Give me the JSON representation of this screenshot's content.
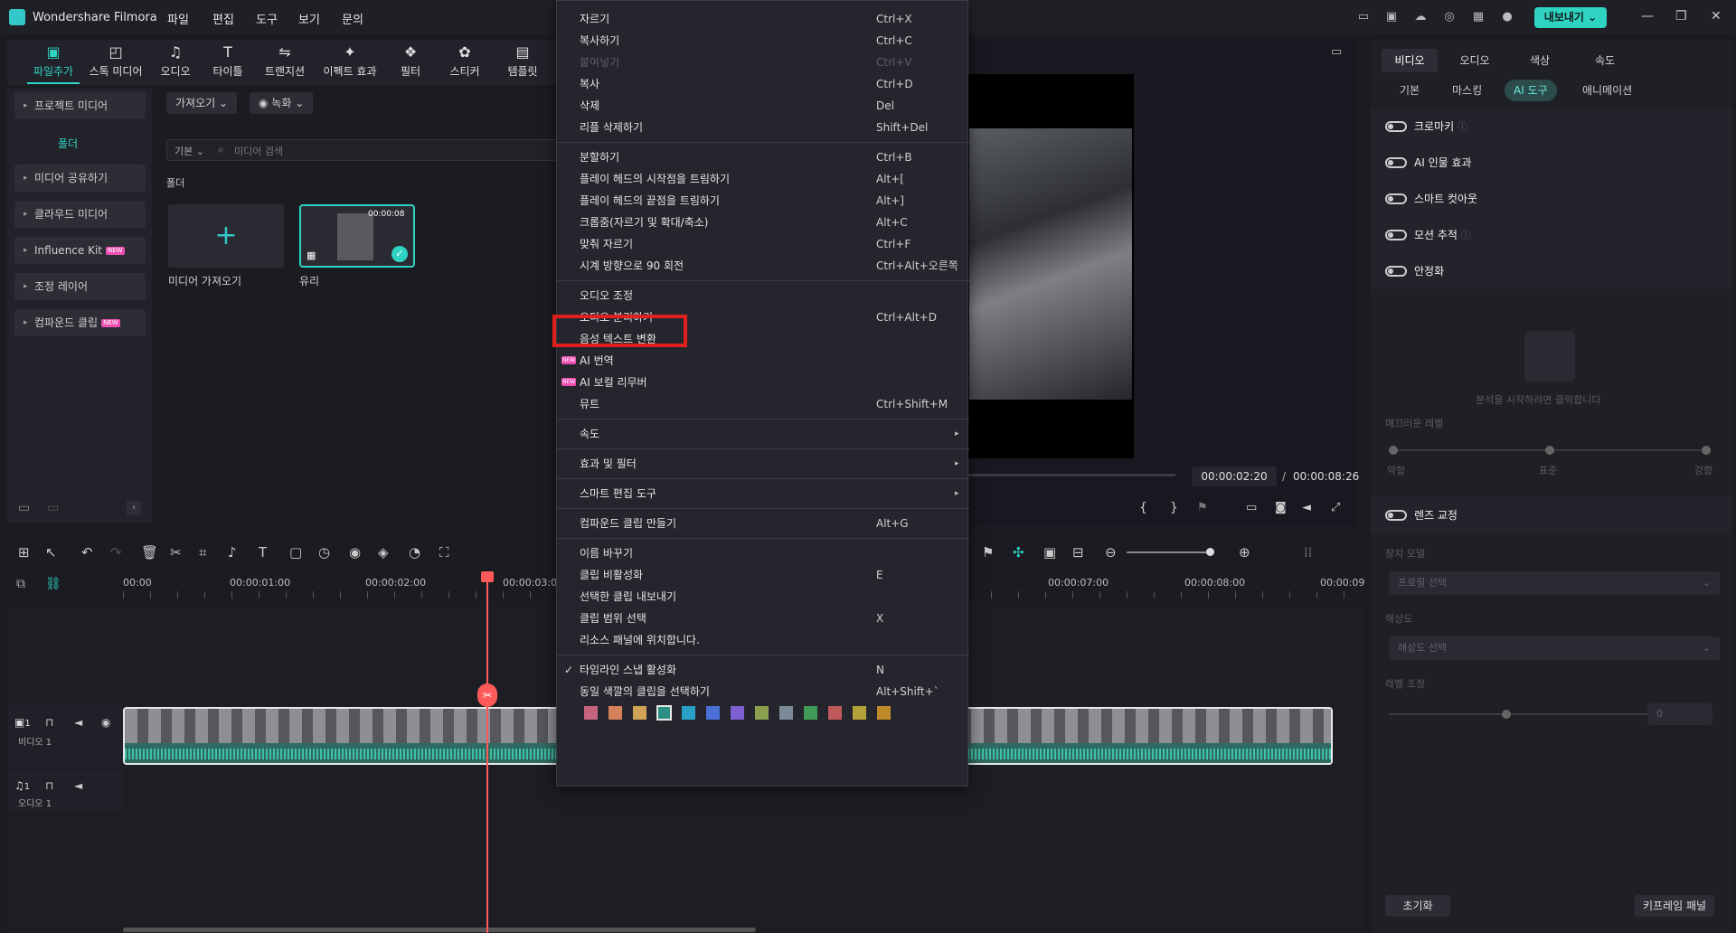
{
  "app": {
    "title": "Wondershare Filmora",
    "menus": [
      "파일",
      "편집",
      "도구",
      "보기",
      "문의"
    ],
    "export_label": "내보내기"
  },
  "toolbar": {
    "items": [
      "파일추가",
      "스톡 미디어",
      "오디오",
      "타이틀",
      "트랜지션",
      "이펙트 효과",
      "필터",
      "스티커",
      "템플릿"
    ]
  },
  "leftnav": {
    "project_media": "프로젝트 미디어",
    "folder": "폴더",
    "items": [
      "미디어 공유하기",
      "클라우드 미디어",
      "Influence Kit",
      "조정 레이어",
      "컴파운드 클립"
    ],
    "new_badge": "NEW"
  },
  "media": {
    "import_label": "가져오기",
    "record_label": "녹화",
    "view_label": "기본",
    "search_placeholder": "미디어 검색",
    "folder_label": "폴더",
    "add_media_label": "미디어 가져오기",
    "clip_name": "유리",
    "clip_duration": "00:00:08"
  },
  "preview": {
    "current_time": "00:00:02:20",
    "separator": "/",
    "total_time": "00:00:08:26"
  },
  "rightpanel": {
    "tabs": [
      "비디오",
      "오디오",
      "색상",
      "속도"
    ],
    "subtabs": [
      "기본",
      "마스킹",
      "AI 도구",
      "애니메이션"
    ],
    "toggles": [
      "크로마키",
      "AI 인물 효과",
      "스마트 컷아웃",
      "모션 추적",
      "안정화"
    ],
    "analyze_hint": "분석을 시작하려면 클릭합니다",
    "smooth_level": "매끄러운 레벨",
    "slider_labels": [
      "약함",
      "표준",
      "강함"
    ],
    "lens_correction": "렌즈 교정",
    "device_model": "장치 모델",
    "profile_select": "프로필 선택",
    "resolution": "해상도",
    "resolution_select": "해상도 선택",
    "level_adjust": "레벨 조정",
    "level_value": "0",
    "reset_label": "초기화",
    "keyframe_panel": "키프레임 패널"
  },
  "timeline": {
    "ruler": [
      "00:00",
      "00:00:01:00",
      "00:00:02:00",
      "00:00:03:0",
      "00:00:07:00",
      "00:00:08:00",
      "00:00:09"
    ],
    "video_track": "비디오 1",
    "audio_track": "오디오 1",
    "track_num": "1"
  },
  "context_menu": {
    "groups": [
      [
        {
          "label": "자르기",
          "shortcut": "Ctrl+X"
        },
        {
          "label": "복사하기",
          "shortcut": "Ctrl+C"
        },
        {
          "label": "붙여넣기",
          "shortcut": "Ctrl+V",
          "disabled": true
        },
        {
          "label": "복사",
          "shortcut": "Ctrl+D"
        },
        {
          "label": "삭제",
          "shortcut": "Del"
        },
        {
          "label": "리플 삭제하기",
          "shortcut": "Shift+Del"
        }
      ],
      [
        {
          "label": "분할하기",
          "shortcut": "Ctrl+B"
        },
        {
          "label": "플레이 헤드의 시작점을 트림하기",
          "shortcut": "Alt+["
        },
        {
          "label": "플레이 헤드의 끝점을 트림하기",
          "shortcut": "Alt+]"
        },
        {
          "label": "크롭줌(자르기 및 확대/축소)",
          "shortcut": "Alt+C"
        },
        {
          "label": "맞춰 자르기",
          "shortcut": "Ctrl+F"
        },
        {
          "label": "시계 방향으로 90 회전",
          "shortcut": "Ctrl+Alt+오른쪽"
        }
      ],
      [
        {
          "label": "오디오 조정",
          "shortcut": ""
        },
        {
          "label": "오디오 분리하기",
          "shortcut": "Ctrl+Alt+D",
          "highlighted": true
        },
        {
          "label": "음성 텍스트 변환",
          "shortcut": ""
        },
        {
          "label": "AI 번역",
          "shortcut": "",
          "new": true
        },
        {
          "label": "AI 보컬 리무버",
          "shortcut": "",
          "new": true
        },
        {
          "label": "뮤트",
          "shortcut": "Ctrl+Shift+M"
        }
      ],
      [
        {
          "label": "속도",
          "shortcut": "",
          "submenu": true
        }
      ],
      [
        {
          "label": "효과 및 필터",
          "shortcut": "",
          "submenu": true
        }
      ],
      [
        {
          "label": "스마트 편집 도구",
          "shortcut": "",
          "submenu": true
        }
      ],
      [
        {
          "label": "컴파운드 클립 만들기",
          "shortcut": "Alt+G"
        }
      ],
      [
        {
          "label": "이름 바꾸기",
          "shortcut": ""
        },
        {
          "label": "클립 비활성화",
          "shortcut": "E"
        },
        {
          "label": "선택한 클립 내보내기",
          "shortcut": ""
        },
        {
          "label": "클립 범위 선택",
          "shortcut": "X"
        },
        {
          "label": "리소스 패널에 위치합니다.",
          "shortcut": ""
        }
      ],
      [
        {
          "label": "타임라인 스냅 활성화",
          "shortcut": "N",
          "checked": true
        },
        {
          "label": "동일 색깔의 클립을 선택하기",
          "shortcut": "Alt+Shift+`"
        }
      ]
    ],
    "new_badge": "NEW",
    "swatches": [
      "#c5647f",
      "#d6815a",
      "#cfa456",
      "#2c8f84",
      "#2aa0c9",
      "#4a71d8",
      "#7e5fd1",
      "#8aa04f",
      "#7c8a97",
      "#3f9b57",
      "#c05a5a",
      "#b3a23a",
      "#c08a2a"
    ],
    "selected_swatch": 3
  },
  "colors": {
    "accent": "#2ed3c2",
    "highlight_box": "#e0201c",
    "playhead": "#ff5a5a"
  }
}
